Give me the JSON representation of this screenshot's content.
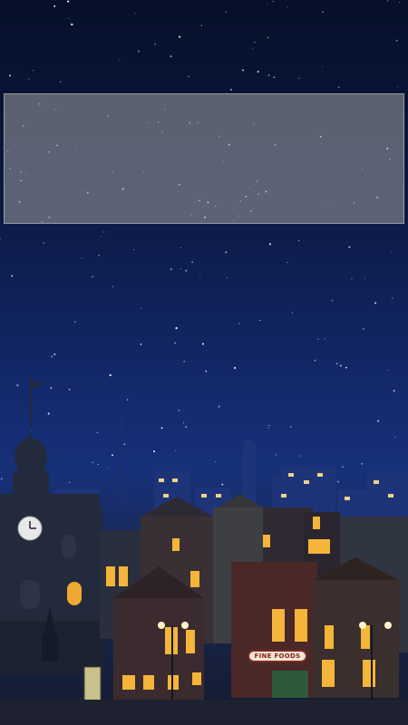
{
  "screen": {
    "widget_area": {
      "content": ""
    },
    "storefront_sign": "FINE FOODS"
  },
  "colors": {
    "sky_top": "#06102a",
    "sky_bottom": "#16307a",
    "window_light": "#f5b43a",
    "widget_panel": "#9b9b9b"
  }
}
